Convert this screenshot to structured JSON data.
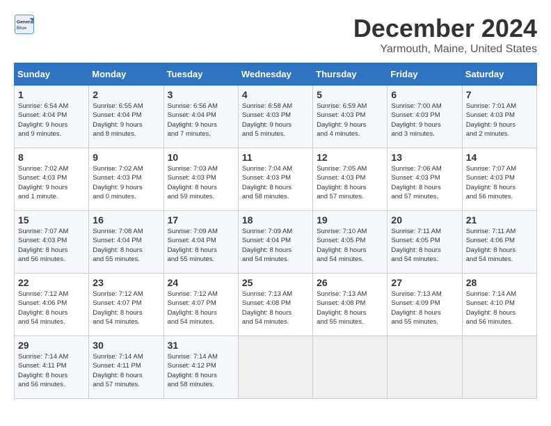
{
  "logo": {
    "text_general": "General",
    "text_blue": "Blue"
  },
  "title": "December 2024",
  "subtitle": "Yarmouth, Maine, United States",
  "headers": [
    "Sunday",
    "Monday",
    "Tuesday",
    "Wednesday",
    "Thursday",
    "Friday",
    "Saturday"
  ],
  "weeks": [
    [
      {
        "day": "1",
        "info": "Sunrise: 6:54 AM\nSunset: 4:04 PM\nDaylight: 9 hours\nand 9 minutes."
      },
      {
        "day": "2",
        "info": "Sunrise: 6:55 AM\nSunset: 4:04 PM\nDaylight: 9 hours\nand 8 minutes."
      },
      {
        "day": "3",
        "info": "Sunrise: 6:56 AM\nSunset: 4:04 PM\nDaylight: 9 hours\nand 7 minutes."
      },
      {
        "day": "4",
        "info": "Sunrise: 6:58 AM\nSunset: 4:03 PM\nDaylight: 9 hours\nand 5 minutes."
      },
      {
        "day": "5",
        "info": "Sunrise: 6:59 AM\nSunset: 4:03 PM\nDaylight: 9 hours\nand 4 minutes."
      },
      {
        "day": "6",
        "info": "Sunrise: 7:00 AM\nSunset: 4:03 PM\nDaylight: 9 hours\nand 3 minutes."
      },
      {
        "day": "7",
        "info": "Sunrise: 7:01 AM\nSunset: 4:03 PM\nDaylight: 9 hours\nand 2 minutes."
      }
    ],
    [
      {
        "day": "8",
        "info": "Sunrise: 7:02 AM\nSunset: 4:03 PM\nDaylight: 9 hours\nand 1 minute."
      },
      {
        "day": "9",
        "info": "Sunrise: 7:02 AM\nSunset: 4:03 PM\nDaylight: 9 hours\nand 0 minutes."
      },
      {
        "day": "10",
        "info": "Sunrise: 7:03 AM\nSunset: 4:03 PM\nDaylight: 8 hours\nand 59 minutes."
      },
      {
        "day": "11",
        "info": "Sunrise: 7:04 AM\nSunset: 4:03 PM\nDaylight: 8 hours\nand 58 minutes."
      },
      {
        "day": "12",
        "info": "Sunrise: 7:05 AM\nSunset: 4:03 PM\nDaylight: 8 hours\nand 57 minutes."
      },
      {
        "day": "13",
        "info": "Sunrise: 7:06 AM\nSunset: 4:03 PM\nDaylight: 8 hours\nand 57 minutes."
      },
      {
        "day": "14",
        "info": "Sunrise: 7:07 AM\nSunset: 4:03 PM\nDaylight: 8 hours\nand 56 minutes."
      }
    ],
    [
      {
        "day": "15",
        "info": "Sunrise: 7:07 AM\nSunset: 4:03 PM\nDaylight: 8 hours\nand 56 minutes."
      },
      {
        "day": "16",
        "info": "Sunrise: 7:08 AM\nSunset: 4:04 PM\nDaylight: 8 hours\nand 55 minutes."
      },
      {
        "day": "17",
        "info": "Sunrise: 7:09 AM\nSunset: 4:04 PM\nDaylight: 8 hours\nand 55 minutes."
      },
      {
        "day": "18",
        "info": "Sunrise: 7:09 AM\nSunset: 4:04 PM\nDaylight: 8 hours\nand 54 minutes."
      },
      {
        "day": "19",
        "info": "Sunrise: 7:10 AM\nSunset: 4:05 PM\nDaylight: 8 hours\nand 54 minutes."
      },
      {
        "day": "20",
        "info": "Sunrise: 7:11 AM\nSunset: 4:05 PM\nDaylight: 8 hours\nand 54 minutes."
      },
      {
        "day": "21",
        "info": "Sunrise: 7:11 AM\nSunset: 4:06 PM\nDaylight: 8 hours\nand 54 minutes."
      }
    ],
    [
      {
        "day": "22",
        "info": "Sunrise: 7:12 AM\nSunset: 4:06 PM\nDaylight: 8 hours\nand 54 minutes."
      },
      {
        "day": "23",
        "info": "Sunrise: 7:12 AM\nSunset: 4:07 PM\nDaylight: 8 hours\nand 54 minutes."
      },
      {
        "day": "24",
        "info": "Sunrise: 7:12 AM\nSunset: 4:07 PM\nDaylight: 8 hours\nand 54 minutes."
      },
      {
        "day": "25",
        "info": "Sunrise: 7:13 AM\nSunset: 4:08 PM\nDaylight: 8 hours\nand 54 minutes."
      },
      {
        "day": "26",
        "info": "Sunrise: 7:13 AM\nSunset: 4:08 PM\nDaylight: 8 hours\nand 55 minutes."
      },
      {
        "day": "27",
        "info": "Sunrise: 7:13 AM\nSunset: 4:09 PM\nDaylight: 8 hours\nand 55 minutes."
      },
      {
        "day": "28",
        "info": "Sunrise: 7:14 AM\nSunset: 4:10 PM\nDaylight: 8 hours\nand 56 minutes."
      }
    ],
    [
      {
        "day": "29",
        "info": "Sunrise: 7:14 AM\nSunset: 4:11 PM\nDaylight: 8 hours\nand 56 minutes."
      },
      {
        "day": "30",
        "info": "Sunrise: 7:14 AM\nSunset: 4:11 PM\nDaylight: 8 hours\nand 57 minutes."
      },
      {
        "day": "31",
        "info": "Sunrise: 7:14 AM\nSunset: 4:12 PM\nDaylight: 8 hours\nand 58 minutes."
      },
      {
        "day": "",
        "info": ""
      },
      {
        "day": "",
        "info": ""
      },
      {
        "day": "",
        "info": ""
      },
      {
        "day": "",
        "info": ""
      }
    ]
  ]
}
